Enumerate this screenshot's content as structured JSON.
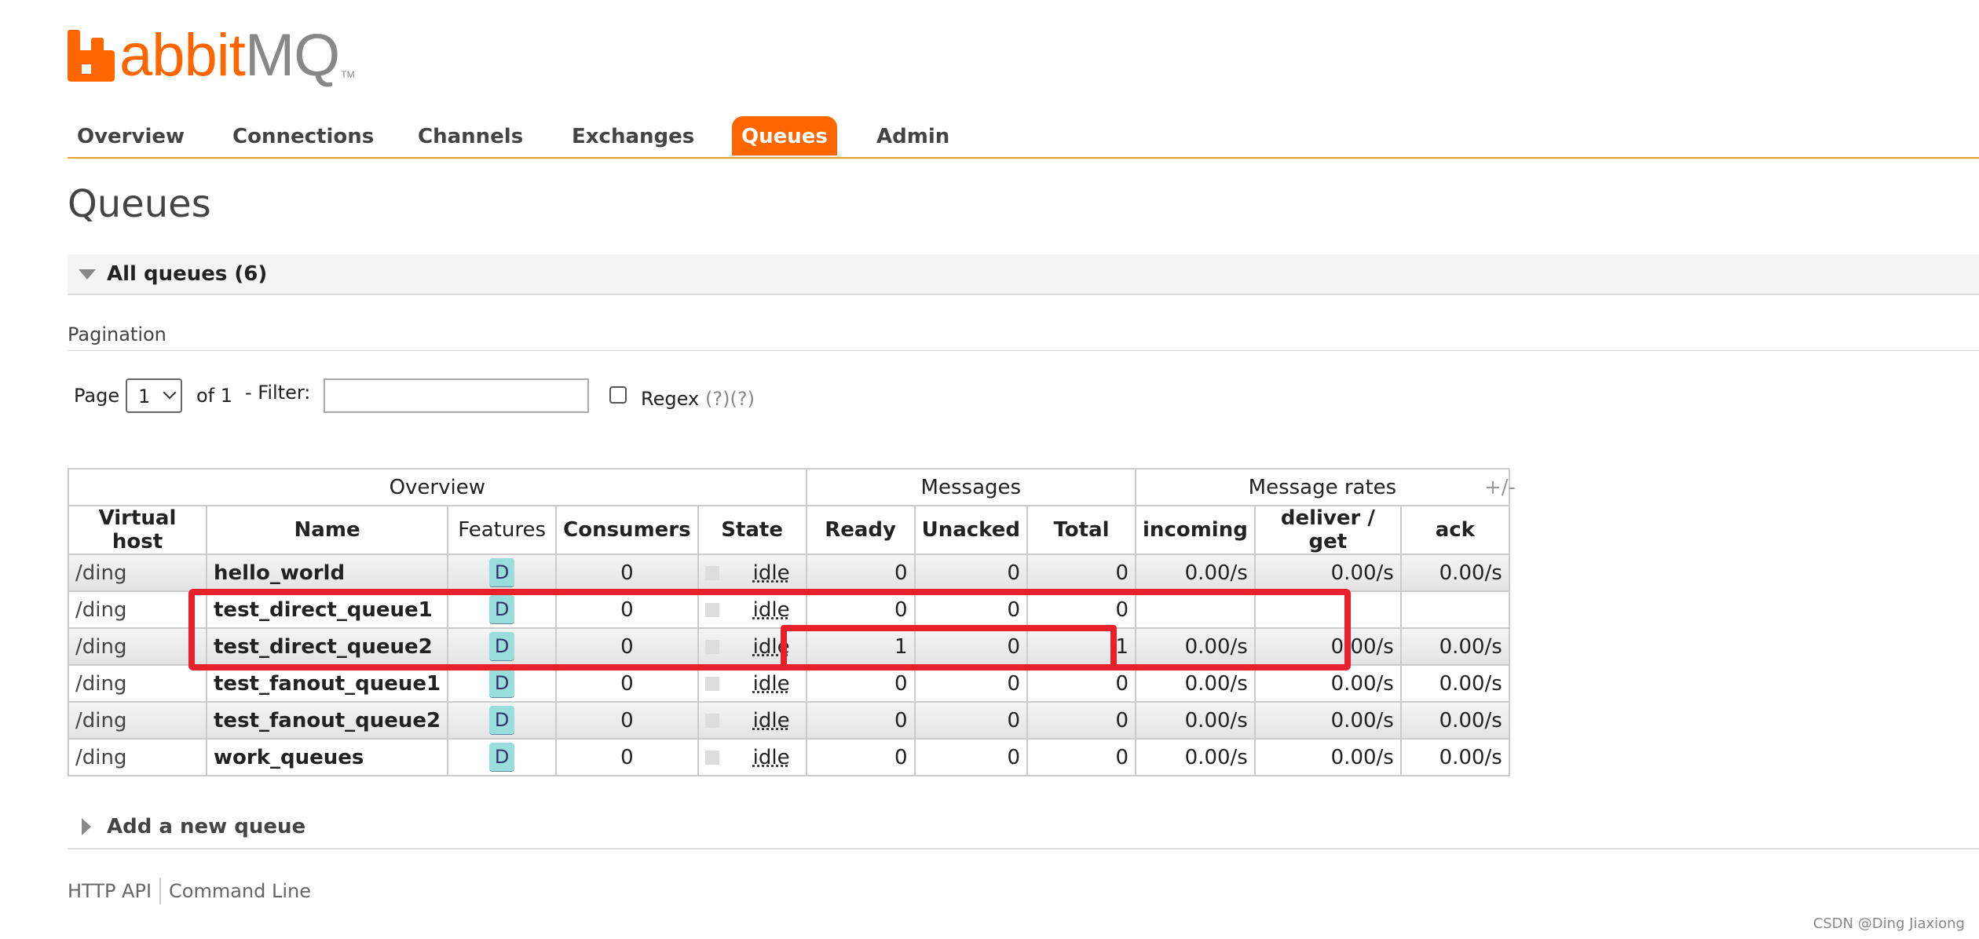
{
  "brand": {
    "logo_r": "R",
    "logo_rest": "abbit",
    "logo_mq": "MQ",
    "tm": "TM",
    "accent": "#ff6600"
  },
  "nav": {
    "tabs": [
      {
        "label": "Overview",
        "active": false
      },
      {
        "label": "Connections",
        "active": false
      },
      {
        "label": "Channels",
        "active": false
      },
      {
        "label": "Exchanges",
        "active": false
      },
      {
        "label": "Queues",
        "active": true
      },
      {
        "label": "Admin",
        "active": false
      }
    ]
  },
  "page_title": "Queues",
  "section": {
    "label": "All queues (6)"
  },
  "pagination": {
    "label": "Pagination",
    "page_label": "Page",
    "page_value": "1",
    "of_label": "of 1",
    "filter_label": "- Filter:",
    "filter_value": "",
    "regex_label": "Regex",
    "regex_help": "(?)(?)"
  },
  "table": {
    "groups": [
      "Overview",
      "Messages",
      "Message rates"
    ],
    "columns": [
      "Virtual host",
      "Name",
      "Features",
      "Consumers",
      "State",
      "Ready",
      "Unacked",
      "Total",
      "incoming",
      "deliver / get",
      "ack"
    ],
    "toggle_columns": "+/-",
    "rows": [
      {
        "vhost": "/ding",
        "name": "hello_world",
        "features": "D",
        "consumers": "0",
        "state": "idle",
        "ready": "0",
        "unacked": "0",
        "total": "0",
        "incoming": "0.00/s",
        "deliver": "0.00/s",
        "ack": "0.00/s"
      },
      {
        "vhost": "/ding",
        "name": "test_direct_queue1",
        "features": "D",
        "consumers": "0",
        "state": "idle",
        "ready": "0",
        "unacked": "0",
        "total": "0",
        "incoming": "",
        "deliver": "",
        "ack": ""
      },
      {
        "vhost": "/ding",
        "name": "test_direct_queue2",
        "features": "D",
        "consumers": "0",
        "state": "idle",
        "ready": "1",
        "unacked": "0",
        "total": "1",
        "incoming": "0.00/s",
        "deliver": "0.00/s",
        "ack": "0.00/s"
      },
      {
        "vhost": "/ding",
        "name": "test_fanout_queue1",
        "features": "D",
        "consumers": "0",
        "state": "idle",
        "ready": "0",
        "unacked": "0",
        "total": "0",
        "incoming": "0.00/s",
        "deliver": "0.00/s",
        "ack": "0.00/s"
      },
      {
        "vhost": "/ding",
        "name": "test_fanout_queue2",
        "features": "D",
        "consumers": "0",
        "state": "idle",
        "ready": "0",
        "unacked": "0",
        "total": "0",
        "incoming": "0.00/s",
        "deliver": "0.00/s",
        "ack": "0.00/s"
      },
      {
        "vhost": "/ding",
        "name": "work_queues",
        "features": "D",
        "consumers": "0",
        "state": "idle",
        "ready": "0",
        "unacked": "0",
        "total": "0",
        "incoming": "0.00/s",
        "deliver": "0.00/s",
        "ack": "0.00/s"
      }
    ]
  },
  "add_queue": {
    "label": "Add a new queue"
  },
  "footer": {
    "http_api": "HTTP API",
    "command_line": "Command Line"
  },
  "watermark": "CSDN @Ding Jiaxiong",
  "highlight_color": "#e8202a"
}
